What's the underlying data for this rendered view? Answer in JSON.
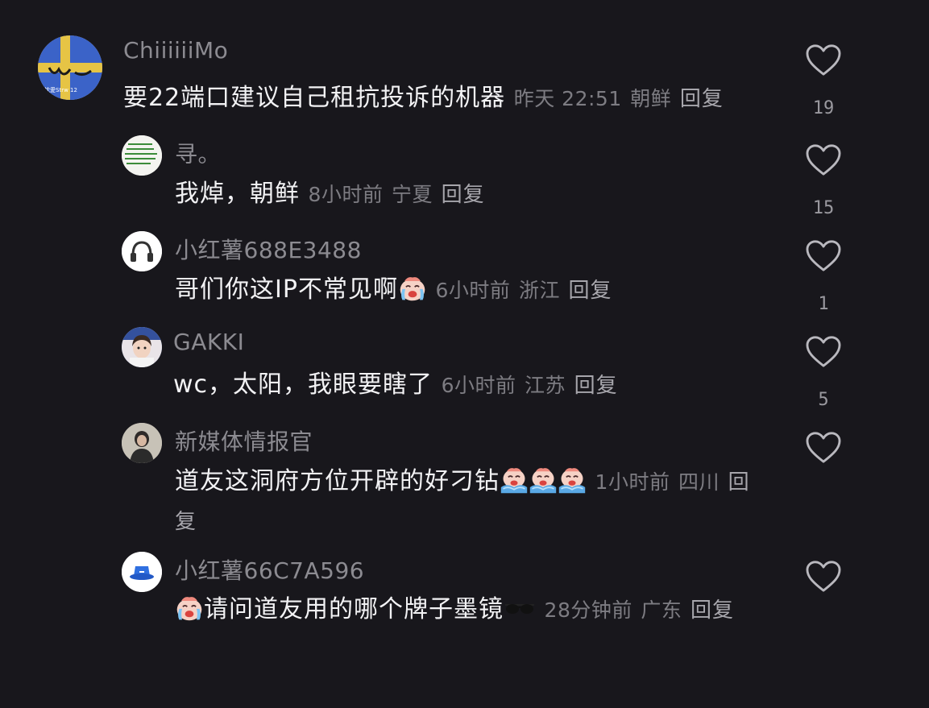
{
  "comments": [
    {
      "username": "ChiiiiiiMo",
      "text": "要22端口建议自己租抗投诉的机器",
      "time": "昨天 22:51",
      "location": "朝鲜",
      "reply": "回复",
      "likes": "19",
      "avatar_text": "枕愛Strw 12"
    },
    {
      "username": "寻。",
      "text": "我焯，朝鲜",
      "time": "8小时前",
      "location": "宁夏",
      "reply": "回复",
      "likes": "15"
    },
    {
      "username": "小红薯688E3488",
      "text": "哥们你这IP不常见啊",
      "time": "6小时前",
      "location": "浙江",
      "reply": "回复",
      "likes": "1"
    },
    {
      "username": "GAKKI",
      "text": "wc，太阳，我眼要瞎了",
      "time": "6小时前",
      "location": "江苏",
      "reply": "回复",
      "likes": "5"
    },
    {
      "username": "新媒体情报官",
      "text": "道友这洞府方位开辟的好刁钻",
      "time": "1小时前",
      "location": "四川",
      "reply": "回复",
      "likes": ""
    },
    {
      "username": "小红薯66C7A596",
      "text": "请问道友用的哪个牌子墨镜",
      "time": "28分钟前",
      "location": "广东",
      "reply": "回复",
      "likes": ""
    }
  ],
  "colors": {
    "background": "#18171c",
    "username": "#8c8b91",
    "text": "#f2f2f4",
    "meta": "#7d7c82"
  },
  "icons": [
    "heart-outline-icon",
    "crying-emoji-icon",
    "sunglasses-emoji-icon"
  ]
}
